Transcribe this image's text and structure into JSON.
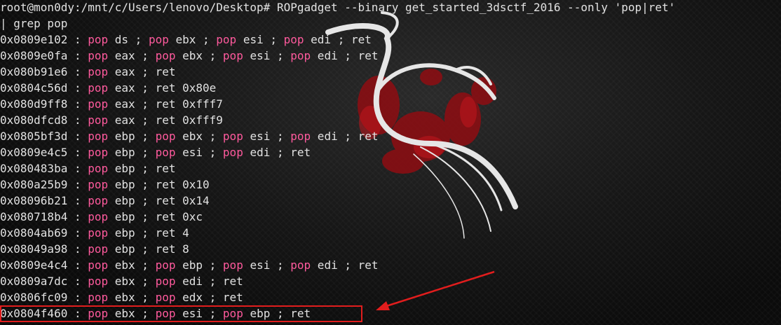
{
  "terminal": {
    "command_line_1": "root@mon0dy:/mnt/c/Users/lenovo/Desktop# ROPgadget --binary get_started_3dsctf_2016 --only 'pop|ret'",
    "command_line_2": "| grep pop",
    "gadgets": [
      {
        "addr": "0x0809e102",
        "instr": "pop ds ; pop ebx ; pop esi ; pop edi ; ret"
      },
      {
        "addr": "0x0809e0fa",
        "instr": "pop eax ; pop ebx ; pop esi ; pop edi ; ret"
      },
      {
        "addr": "0x080b91e6",
        "instr": "pop eax ; ret"
      },
      {
        "addr": "0x0804c56d",
        "instr": "pop eax ; ret 0x80e"
      },
      {
        "addr": "0x080d9ff8",
        "instr": "pop eax ; ret 0xfff7"
      },
      {
        "addr": "0x080dfcd8",
        "instr": "pop eax ; ret 0xfff9"
      },
      {
        "addr": "0x0805bf3d",
        "instr": "pop ebp ; pop ebx ; pop esi ; pop edi ; ret"
      },
      {
        "addr": "0x0809e4c5",
        "instr": "pop ebp ; pop esi ; pop edi ; ret"
      },
      {
        "addr": "0x080483ba",
        "instr": "pop ebp ; ret"
      },
      {
        "addr": "0x080a25b9",
        "instr": "pop ebp ; ret 0x10"
      },
      {
        "addr": "0x08096b21",
        "instr": "pop ebp ; ret 0x14"
      },
      {
        "addr": "0x080718b4",
        "instr": "pop ebp ; ret 0xc"
      },
      {
        "addr": "0x0804ab69",
        "instr": "pop ebp ; ret 4"
      },
      {
        "addr": "0x08049a98",
        "instr": "pop ebp ; ret 8"
      },
      {
        "addr": "0x0809e4c4",
        "instr": "pop ebx ; pop ebp ; pop esi ; pop edi ; ret"
      },
      {
        "addr": "0x0809a7dc",
        "instr": "pop ebx ; pop edi ; ret"
      },
      {
        "addr": "0x0806fc09",
        "instr": "pop ebx ; pop edx ; ret"
      },
      {
        "addr": "0x0804f460",
        "instr": "pop ebx ; pop esi ; pop ebp ; ret",
        "highlighted": true
      }
    ]
  },
  "colors": {
    "text": "#e2e2e2",
    "keyword_pop": "#ff5a9d",
    "annotation_red": "#e11d1d",
    "background": "#0b0b0b"
  },
  "icons": {
    "background_logo": "kali-dragon-icon",
    "annotation_arrow": "red-arrow-icon"
  }
}
